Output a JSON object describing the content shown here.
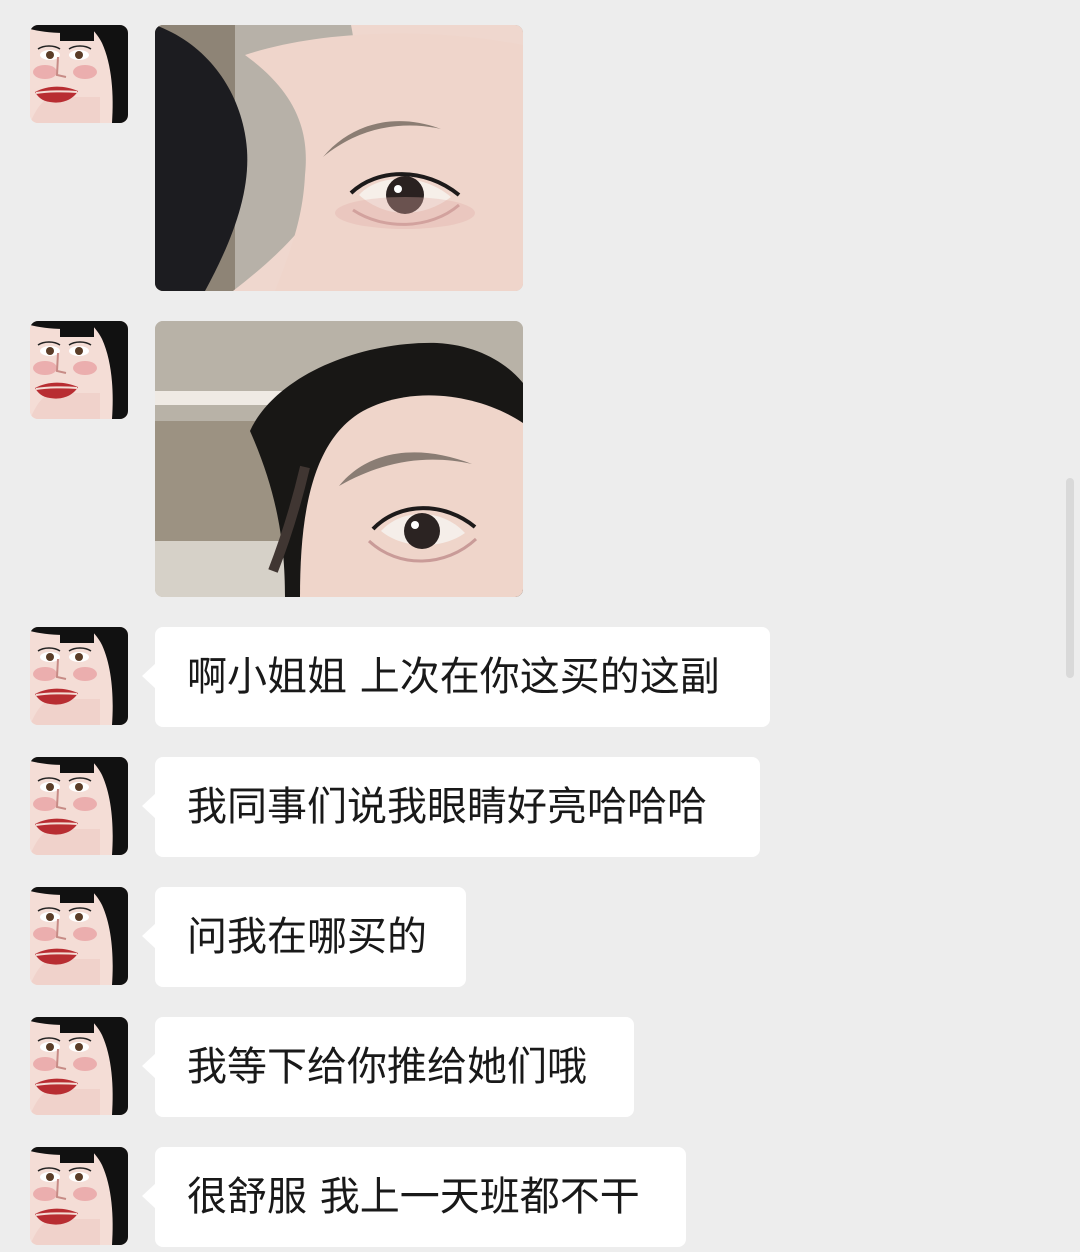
{
  "chat": {
    "messages": [
      {
        "type": "image",
        "content": "selfie-eye-closeup-1",
        "avatar": "avatar-illustrated-woman"
      },
      {
        "type": "image",
        "content": "selfie-eye-closeup-2",
        "avatar": "avatar-illustrated-woman"
      },
      {
        "type": "text",
        "text": "啊小姐姐 上次在你这买的这副",
        "avatar": "avatar-illustrated-woman"
      },
      {
        "type": "text",
        "text": "我同事们说我眼睛好亮哈哈哈",
        "avatar": "avatar-illustrated-woman"
      },
      {
        "type": "text",
        "text": "问我在哪买的",
        "avatar": "avatar-illustrated-woman"
      },
      {
        "type": "text",
        "text": "我等下给你推给她们哦",
        "avatar": "avatar-illustrated-woman"
      },
      {
        "type": "text",
        "text": "很舒服 我上一天班都不干",
        "avatar": "avatar-illustrated-woman"
      }
    ]
  },
  "colors": {
    "background": "#ededed",
    "bubble": "#ffffff",
    "text": "#191919"
  }
}
